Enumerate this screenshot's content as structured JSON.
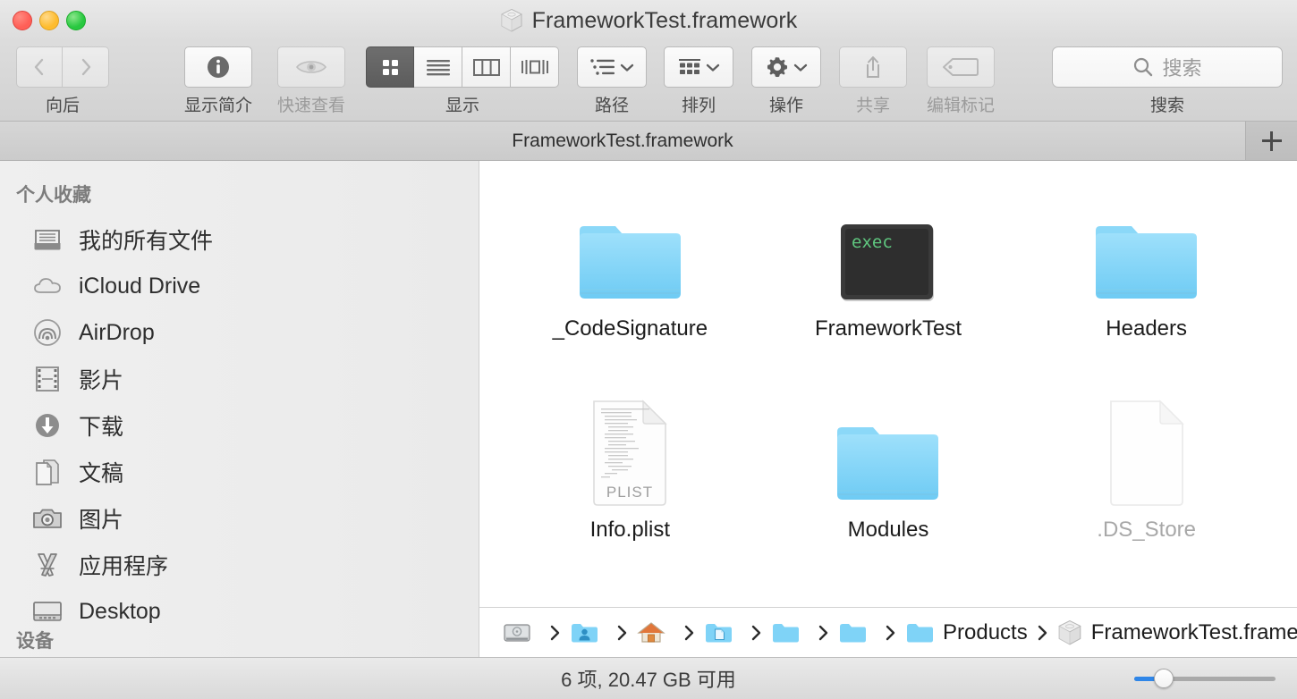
{
  "window": {
    "title": "FrameworkTest.framework",
    "title_icon": "framework-cube-icon",
    "traffic_lights": [
      "close-button",
      "minimize-button",
      "zoom-button"
    ]
  },
  "toolbar": {
    "nav": {
      "label": "向后",
      "back_icon": "chevron-left-icon",
      "forward_icon": "chevron-right-icon"
    },
    "get_info": {
      "label": "显示简介",
      "icon": "info-circle-icon"
    },
    "quick_look": {
      "label": "快速查看",
      "icon": "eye-icon"
    },
    "view": {
      "label": "显示",
      "options": [
        "icon-view",
        "list-view",
        "column-view",
        "coverflow-view"
      ],
      "selected": "icon-view"
    },
    "path": {
      "label": "路径",
      "icon": "bulleted-list-icon"
    },
    "arrange": {
      "label": "排列",
      "icon": "grid-dots-icon"
    },
    "action": {
      "label": "操作",
      "icon": "gear-icon"
    },
    "share": {
      "label": "共享",
      "icon": "share-arrow-icon"
    },
    "edit_tags": {
      "label": "编辑标记",
      "icon": "tag-icon"
    },
    "search": {
      "label": "搜索",
      "placeholder": "搜索",
      "icon": "search-icon"
    }
  },
  "tabbar": {
    "tabs": [
      {
        "label": "FrameworkTest.framework",
        "active": true
      }
    ],
    "add_tab_icon": "plus-icon"
  },
  "sidebar": {
    "sections": [
      {
        "header": "个人收藏",
        "items": [
          {
            "label": "我的所有文件",
            "icon": "all-my-files-icon"
          },
          {
            "label": "iCloud Drive",
            "icon": "cloud-icon"
          },
          {
            "label": "AirDrop",
            "icon": "airdrop-icon"
          },
          {
            "label": "影片",
            "icon": "movies-film-icon"
          },
          {
            "label": "下载",
            "icon": "downloads-arrow-icon"
          },
          {
            "label": "文稿",
            "icon": "documents-icon"
          },
          {
            "label": "图片",
            "icon": "pictures-camera-icon"
          },
          {
            "label": "应用程序",
            "icon": "applications-icon"
          },
          {
            "label": "Desktop",
            "icon": "desktop-icon"
          }
        ]
      },
      {
        "header": "设备",
        "items": []
      }
    ]
  },
  "files": [
    {
      "name": "_CodeSignature",
      "icon": "folder-icon",
      "kind": "folder",
      "dimmed": false
    },
    {
      "name": "FrameworkTest",
      "icon": "executable-terminal-icon",
      "kind": "executable",
      "badge": "exec",
      "dimmed": false
    },
    {
      "name": "Headers",
      "icon": "folder-icon",
      "kind": "folder",
      "dimmed": false
    },
    {
      "name": "Info.plist",
      "icon": "plist-document-icon",
      "kind": "document",
      "badge": "PLIST",
      "dimmed": false
    },
    {
      "name": "Modules",
      "icon": "folder-icon",
      "kind": "folder",
      "dimmed": false
    },
    {
      "name": ".DS_Store",
      "icon": "blank-document-icon",
      "kind": "document",
      "dimmed": true
    }
  ],
  "pathbar": {
    "crumbs": [
      {
        "label": "",
        "icon": "hard-disk-icon"
      },
      {
        "label": "",
        "icon": "users-folder-icon"
      },
      {
        "label": "",
        "icon": "home-folder-icon"
      },
      {
        "label": "",
        "icon": "documents-folder-icon"
      },
      {
        "label": "",
        "icon": "folder-icon"
      },
      {
        "label": "",
        "icon": "folder-icon"
      },
      {
        "label": "Products",
        "icon": "folder-icon"
      },
      {
        "label": "FrameworkTest.framework",
        "icon": "framework-cube-icon"
      }
    ],
    "separator_icon": "chevron-right-small-icon"
  },
  "statusbar": {
    "text": "6 项, 20.47 GB 可用",
    "zoom_slider": {
      "value": 18,
      "accent": "#2f86e8"
    }
  },
  "colors": {
    "folder_blue": "#7fd3f7",
    "accent_blue": "#2f86e8",
    "exec_green": "#53c17a",
    "toolbar_gray": "#d4d4d4",
    "sidebar_gray": "#ededed"
  }
}
